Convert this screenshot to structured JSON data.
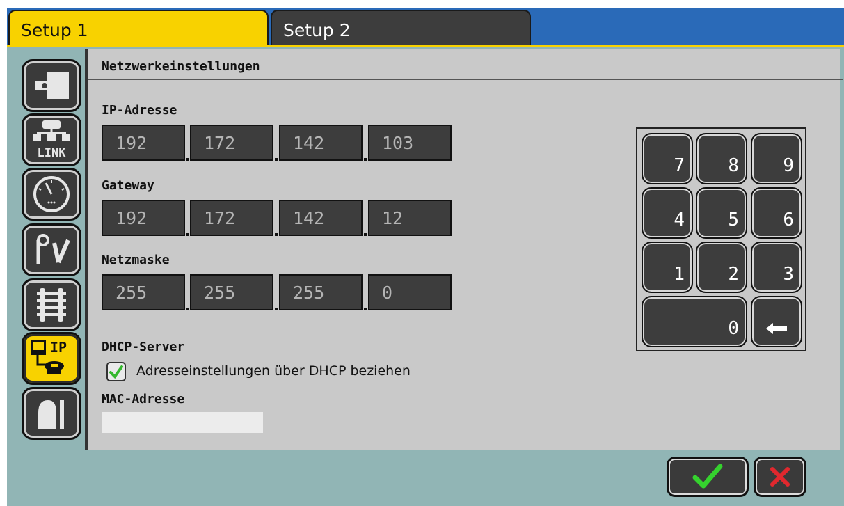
{
  "tabs": [
    {
      "label": "Setup 1",
      "active": true
    },
    {
      "label": "Setup 2",
      "active": false
    }
  ],
  "sidebar": {
    "items": [
      {
        "icon": "module-icon"
      },
      {
        "icon": "link-icon",
        "label": "LINK"
      },
      {
        "icon": "gauge-icon"
      },
      {
        "icon": "signal-switch-icon"
      },
      {
        "icon": "track-icon"
      },
      {
        "icon": "network-ip-icon",
        "label": "IP",
        "active": true
      },
      {
        "icon": "tunnel-icon"
      }
    ]
  },
  "section": {
    "title": "Netzwerkeinstellungen"
  },
  "ip_address": {
    "label": "IP-Adresse",
    "octets": [
      "192",
      "172",
      "142",
      "103"
    ]
  },
  "gateway": {
    "label": "Gateway",
    "octets": [
      "192",
      "172",
      "142",
      "12"
    ]
  },
  "netmask": {
    "label": "Netzmaske",
    "octets": [
      "255",
      "255",
      "255",
      "0"
    ]
  },
  "dhcp": {
    "label": "DHCP-Server",
    "checkbox_label": "Adresseinstellungen über DHCP beziehen",
    "checked": true
  },
  "mac": {
    "label": "MAC-Adresse"
  },
  "keypad": {
    "keys": [
      "7",
      "8",
      "9",
      "4",
      "5",
      "6",
      "1",
      "2",
      "3",
      "0"
    ]
  },
  "colors": {
    "accent_yellow": "#f8d200",
    "top_blue": "#2a6ab8",
    "frame_teal": "#91b5b5",
    "panel_gray": "#c9c9c9",
    "field_dark": "#3d3d3d",
    "confirm_green": "#35d22e",
    "cancel_red": "#e0282e"
  }
}
